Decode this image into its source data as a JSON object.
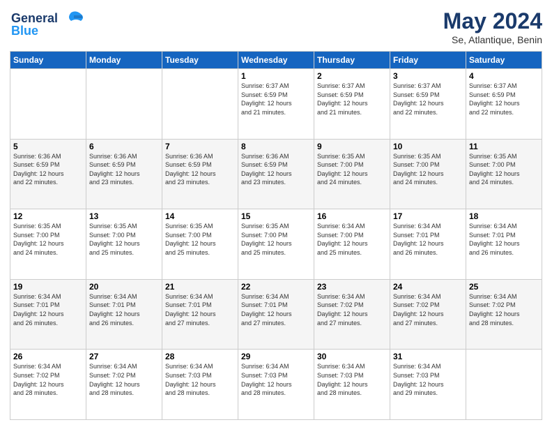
{
  "logo": {
    "line1": "General",
    "line2": "Blue"
  },
  "title": "May 2024",
  "location": "Se, Atlantique, Benin",
  "weekdays": [
    "Sunday",
    "Monday",
    "Tuesday",
    "Wednesday",
    "Thursday",
    "Friday",
    "Saturday"
  ],
  "weeks": [
    [
      {
        "day": "",
        "info": ""
      },
      {
        "day": "",
        "info": ""
      },
      {
        "day": "",
        "info": ""
      },
      {
        "day": "1",
        "info": "Sunrise: 6:37 AM\nSunset: 6:59 PM\nDaylight: 12 hours\nand 21 minutes."
      },
      {
        "day": "2",
        "info": "Sunrise: 6:37 AM\nSunset: 6:59 PM\nDaylight: 12 hours\nand 21 minutes."
      },
      {
        "day": "3",
        "info": "Sunrise: 6:37 AM\nSunset: 6:59 PM\nDaylight: 12 hours\nand 22 minutes."
      },
      {
        "day": "4",
        "info": "Sunrise: 6:37 AM\nSunset: 6:59 PM\nDaylight: 12 hours\nand 22 minutes."
      }
    ],
    [
      {
        "day": "5",
        "info": "Sunrise: 6:36 AM\nSunset: 6:59 PM\nDaylight: 12 hours\nand 22 minutes."
      },
      {
        "day": "6",
        "info": "Sunrise: 6:36 AM\nSunset: 6:59 PM\nDaylight: 12 hours\nand 23 minutes."
      },
      {
        "day": "7",
        "info": "Sunrise: 6:36 AM\nSunset: 6:59 PM\nDaylight: 12 hours\nand 23 minutes."
      },
      {
        "day": "8",
        "info": "Sunrise: 6:36 AM\nSunset: 6:59 PM\nDaylight: 12 hours\nand 23 minutes."
      },
      {
        "day": "9",
        "info": "Sunrise: 6:35 AM\nSunset: 7:00 PM\nDaylight: 12 hours\nand 24 minutes."
      },
      {
        "day": "10",
        "info": "Sunrise: 6:35 AM\nSunset: 7:00 PM\nDaylight: 12 hours\nand 24 minutes."
      },
      {
        "day": "11",
        "info": "Sunrise: 6:35 AM\nSunset: 7:00 PM\nDaylight: 12 hours\nand 24 minutes."
      }
    ],
    [
      {
        "day": "12",
        "info": "Sunrise: 6:35 AM\nSunset: 7:00 PM\nDaylight: 12 hours\nand 24 minutes."
      },
      {
        "day": "13",
        "info": "Sunrise: 6:35 AM\nSunset: 7:00 PM\nDaylight: 12 hours\nand 25 minutes."
      },
      {
        "day": "14",
        "info": "Sunrise: 6:35 AM\nSunset: 7:00 PM\nDaylight: 12 hours\nand 25 minutes."
      },
      {
        "day": "15",
        "info": "Sunrise: 6:35 AM\nSunset: 7:00 PM\nDaylight: 12 hours\nand 25 minutes."
      },
      {
        "day": "16",
        "info": "Sunrise: 6:34 AM\nSunset: 7:00 PM\nDaylight: 12 hours\nand 25 minutes."
      },
      {
        "day": "17",
        "info": "Sunrise: 6:34 AM\nSunset: 7:01 PM\nDaylight: 12 hours\nand 26 minutes."
      },
      {
        "day": "18",
        "info": "Sunrise: 6:34 AM\nSunset: 7:01 PM\nDaylight: 12 hours\nand 26 minutes."
      }
    ],
    [
      {
        "day": "19",
        "info": "Sunrise: 6:34 AM\nSunset: 7:01 PM\nDaylight: 12 hours\nand 26 minutes."
      },
      {
        "day": "20",
        "info": "Sunrise: 6:34 AM\nSunset: 7:01 PM\nDaylight: 12 hours\nand 26 minutes."
      },
      {
        "day": "21",
        "info": "Sunrise: 6:34 AM\nSunset: 7:01 PM\nDaylight: 12 hours\nand 27 minutes."
      },
      {
        "day": "22",
        "info": "Sunrise: 6:34 AM\nSunset: 7:01 PM\nDaylight: 12 hours\nand 27 minutes."
      },
      {
        "day": "23",
        "info": "Sunrise: 6:34 AM\nSunset: 7:02 PM\nDaylight: 12 hours\nand 27 minutes."
      },
      {
        "day": "24",
        "info": "Sunrise: 6:34 AM\nSunset: 7:02 PM\nDaylight: 12 hours\nand 27 minutes."
      },
      {
        "day": "25",
        "info": "Sunrise: 6:34 AM\nSunset: 7:02 PM\nDaylight: 12 hours\nand 28 minutes."
      }
    ],
    [
      {
        "day": "26",
        "info": "Sunrise: 6:34 AM\nSunset: 7:02 PM\nDaylight: 12 hours\nand 28 minutes."
      },
      {
        "day": "27",
        "info": "Sunrise: 6:34 AM\nSunset: 7:02 PM\nDaylight: 12 hours\nand 28 minutes."
      },
      {
        "day": "28",
        "info": "Sunrise: 6:34 AM\nSunset: 7:03 PM\nDaylight: 12 hours\nand 28 minutes."
      },
      {
        "day": "29",
        "info": "Sunrise: 6:34 AM\nSunset: 7:03 PM\nDaylight: 12 hours\nand 28 minutes."
      },
      {
        "day": "30",
        "info": "Sunrise: 6:34 AM\nSunset: 7:03 PM\nDaylight: 12 hours\nand 28 minutes."
      },
      {
        "day": "31",
        "info": "Sunrise: 6:34 AM\nSunset: 7:03 PM\nDaylight: 12 hours\nand 29 minutes."
      },
      {
        "day": "",
        "info": ""
      }
    ]
  ]
}
